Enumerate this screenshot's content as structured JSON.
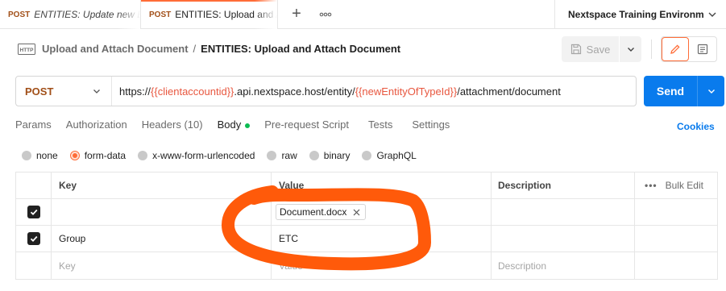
{
  "tabs": [
    {
      "method": "POST",
      "name": "ENTITIES: Update new E"
    },
    {
      "method": "POST",
      "name": "ENTITIES: Upload and A"
    }
  ],
  "tab_add_label": "+",
  "tab_more_label": "ooo",
  "environment": {
    "label": "Nextspace Training Environmer"
  },
  "breadcrumb": {
    "parent": "Upload and Attach Document",
    "separator": "/",
    "current": "ENTITIES: Upload and Attach Document"
  },
  "toolbar": {
    "save_label": "Save"
  },
  "request": {
    "method": "POST",
    "url_parts": {
      "prefix": "https://",
      "var1": "{{clientaccountid}}",
      "mid": ".api.nextspace.host/entity/",
      "var2": "{{newEntityOfTypeId}}",
      "suffix": "/attachment/document"
    },
    "send_label": "Send"
  },
  "request_tabs": {
    "params": "Params",
    "authorization": "Authorization",
    "headers": "Headers",
    "headers_count": "(10)",
    "body": "Body",
    "prerequest": "Pre-request Script",
    "tests": "Tests",
    "settings": "Settings",
    "cookies": "Cookies"
  },
  "body_types": {
    "none": "none",
    "form_data": "form-data",
    "urlencoded": "x-www-form-urlencoded",
    "raw": "raw",
    "binary": "binary",
    "graphql": "GraphQL",
    "selected": "form-data"
  },
  "table": {
    "headers": {
      "key": "Key",
      "value": "Value",
      "description": "Description",
      "bulk_edit": "Bulk Edit",
      "more": "•••"
    },
    "rows": [
      {
        "checked": true,
        "key": "",
        "value_file": "Document.docx",
        "description": ""
      },
      {
        "checked": true,
        "key": "Group",
        "value": "ETC",
        "description": ""
      }
    ],
    "placeholder": {
      "key": "Key",
      "value": "Value",
      "description": "Description"
    }
  },
  "colors": {
    "accent": "#ff6c37",
    "send": "#097bed",
    "method": "#a14f18",
    "variable": "#e8573f",
    "annotation": "#ff5a0a",
    "body_indicator": "#0cbb52"
  }
}
